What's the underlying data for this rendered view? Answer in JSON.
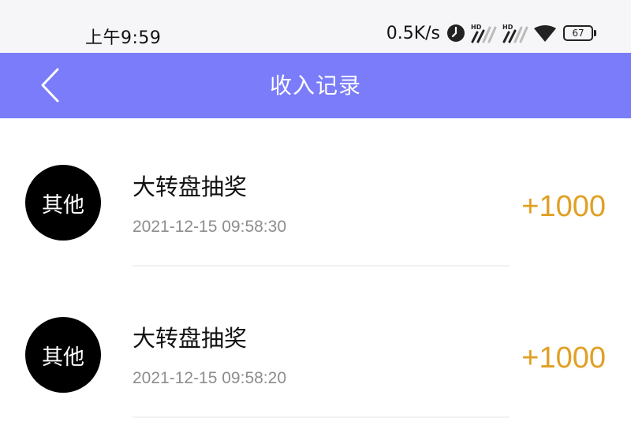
{
  "status_bar": {
    "time": "上午9:59",
    "net_speed": "0.5K/s",
    "battery": "67",
    "icons": [
      "clock-icon",
      "hd-signal-icon",
      "hd-signal-icon",
      "wifi-icon",
      "battery-icon"
    ]
  },
  "header": {
    "back_icon": "chevron-left-icon",
    "title": "收入记录",
    "background_color": "#7a7cf9"
  },
  "records": [
    {
      "avatar_label": "其他",
      "title": "大转盘抽奖",
      "time": "2021-12-15 09:58:30",
      "amount": "+1000"
    },
    {
      "avatar_label": "其他",
      "title": "大转盘抽奖",
      "time": "2021-12-15 09:58:20",
      "amount": "+1000"
    }
  ],
  "colors": {
    "amount": "#e0a024",
    "avatar_bg": "#000000",
    "time_text": "#8d8d8d"
  }
}
